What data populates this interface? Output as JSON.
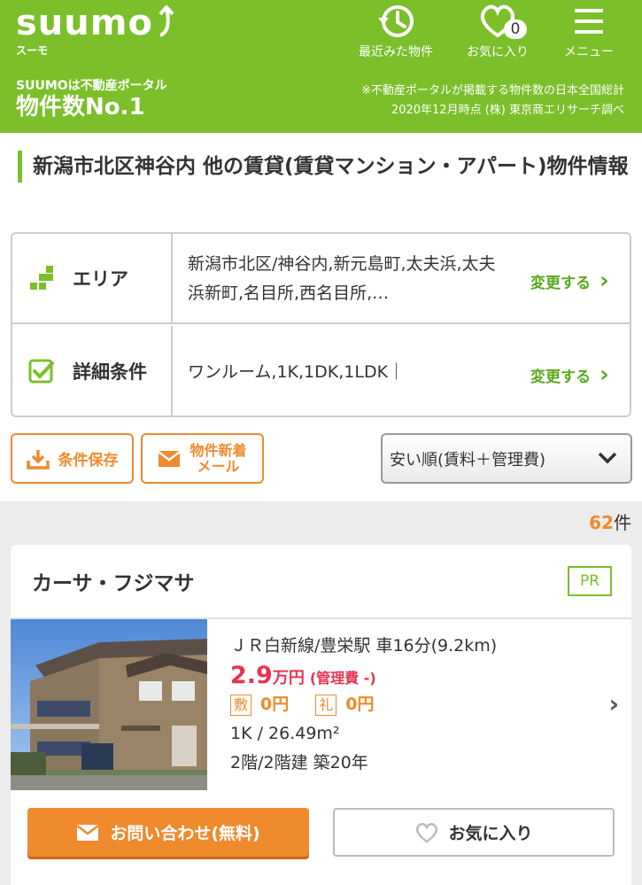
{
  "header": {
    "logo": "suumo",
    "logo_sub": "スーモ",
    "nav": [
      {
        "label": "最近みた物件",
        "icon": "history-icon"
      },
      {
        "label": "お気に入り",
        "icon": "heart-icon",
        "badge": "0"
      },
      {
        "label": "メニュー",
        "icon": "menu-icon"
      }
    ],
    "portal_line1": "SUUMOは不動産ポータル",
    "portal_line2": "物件数No.1",
    "survey_line1": "※不動産ポータルが掲載する物件数の日本全国総計",
    "survey_line2": "2020年12月時点 (株) 東京商エリサーチ調べ"
  },
  "page_title": "新潟市北区神谷内 他の賃貸(賃貸マンション・アパート)物件情報",
  "conditions": {
    "area_label": "エリア",
    "area_value": "新潟市北区/神谷内,新元島町,太夫浜,太夫浜新町,名目所,西名目所,…",
    "detail_label": "詳細条件",
    "detail_value": "ワンルーム,1K,1DK,1LDK｜",
    "change_label": "変更する"
  },
  "actions": {
    "save_label": "条件保存",
    "mail_label_1": "物件新着",
    "mail_label_2": "メール",
    "sort_value": "安い順(賃料＋管理費)"
  },
  "results": {
    "count": "62",
    "count_unit": "件"
  },
  "listing": {
    "name": "カーサ・フジマサ",
    "pr": "PR",
    "access": "ＪＲ白新線/豊栄駅 車16分(9.2km)",
    "rent_num": "2.9",
    "rent_unit": "万円",
    "mgmt": "(管理費 -)",
    "deposit_mark": "敷",
    "deposit": "0円",
    "key_money_mark": "礼",
    "key_money": "0円",
    "layout": "1K / 26.49m²",
    "floor": "2階/2階建 築20年",
    "inquiry_label": "お問い合わせ(無料)",
    "favorite_label": "お気に入り"
  },
  "colors": {
    "brand_green": "#7bbf2a",
    "accent_orange": "#ef8a2d",
    "price_red": "#e53451"
  }
}
